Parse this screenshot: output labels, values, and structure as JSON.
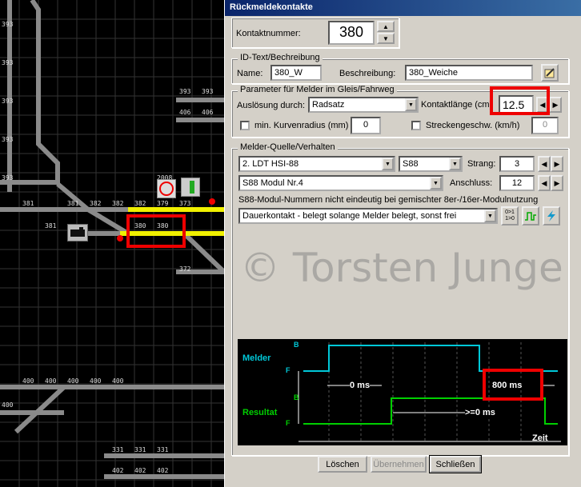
{
  "track": {
    "labels_col0": [
      "393",
      "393",
      "393",
      "393",
      "393",
      "393",
      "393",
      "393",
      "393",
      "393"
    ],
    "row_381": [
      "381",
      "381",
      "382",
      "382",
      "382",
      "382",
      "379"
    ],
    "row_380": [
      "381",
      "380",
      "380"
    ],
    "row_top": [
      "393",
      "393",
      "393"
    ],
    "row_406": [
      "406",
      "406"
    ],
    "row_373": "373",
    "row_372": "372",
    "row_400": [
      "400",
      "400",
      "400",
      "400",
      "400",
      "400",
      "400",
      "400",
      "400",
      "400"
    ],
    "row_402": [
      "402",
      "402",
      "402",
      "402",
      "400"
    ],
    "row_331": [
      "331",
      "331",
      "331",
      "331",
      "331"
    ],
    "sig_label": "2008"
  },
  "dialog": {
    "title": "Rückmeldekontakte",
    "contact_label": "Kontaktnummer:",
    "contact_value": "380",
    "id_group": "ID-Text/Bechreibung",
    "name_label": "Name:",
    "name_value": "380_W",
    "desc_label": "Beschreibung:",
    "desc_value": "380_Weiche",
    "param_group": "Parameter für Melder im Gleis/Fahrweg",
    "trigger_label": "Auslösung durch:",
    "trigger_value": "Radsatz",
    "length_label": "Kontaktlänge (cm)",
    "length_value": "12.5",
    "radius_label": "min. Kurvenradius (mm)",
    "radius_value": "0",
    "speed_label": "Streckengeschw. (km/h)",
    "speed_value": "0",
    "source_group": "Melder-Quelle/Verhalten",
    "interface_value": "2. LDT HSI-88",
    "bus_value": "S88",
    "strang_label": "Strang:",
    "strang_value": "3",
    "module_value": "S88 Modul Nr.4",
    "anschluss_label": "Anschluss:",
    "anschluss_value": "12",
    "note": "S88-Modul-Nummern nicht eindeutig bei gemischter 8er-/16er-Modulnutzung",
    "mode_value": "Dauerkontakt - belegt solange Melder belegt, sonst frei",
    "mode_icon_text": "0>1\n1>0",
    "timing": {
      "melder_label": "Melder",
      "resultat_label": "Resultat",
      "b_label": "B",
      "f_label": "F",
      "delay1": "0 ms",
      "delay2": "800 ms",
      "delay3": ">=0 ms",
      "zeit_label": "Zeit"
    },
    "btn_loeschen": "Löschen",
    "btn_uebernehmen": "Übernehmen",
    "btn_schliessen": "Schließen"
  },
  "watermark": "© Torsten Junge",
  "colors": {
    "track_yellow": "#f0f000",
    "track_gray": "#8a8a8a",
    "highlight_red": "#e00000",
    "melder_cyan": "#00c8d8",
    "result_green": "#00d000"
  }
}
